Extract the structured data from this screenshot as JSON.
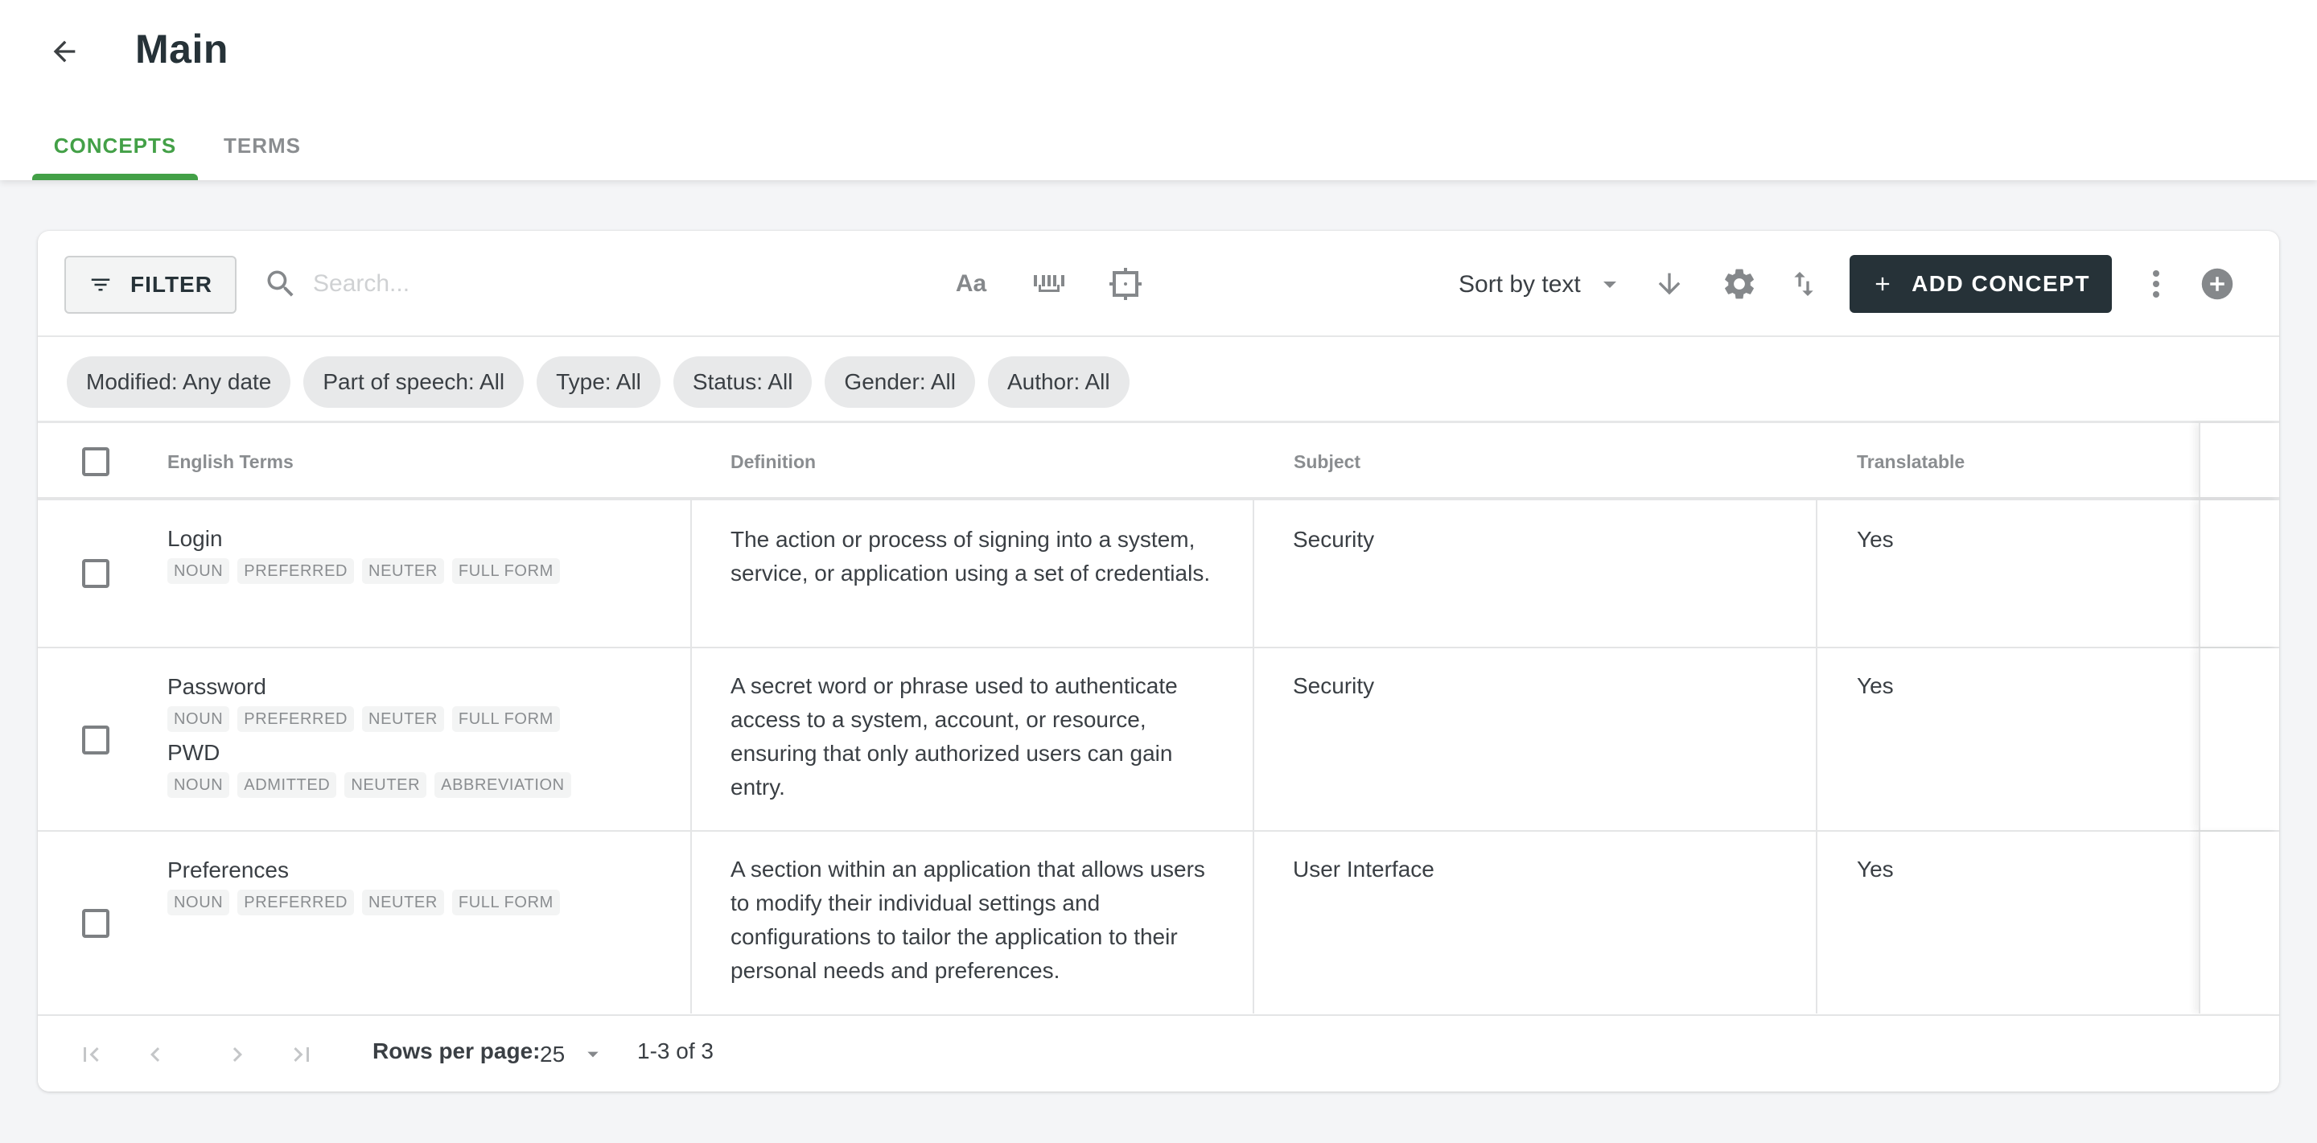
{
  "header": {
    "back_icon": "arrow-left-icon",
    "title": "Main",
    "tabs": [
      {
        "label": "CONCEPTS",
        "active": true
      },
      {
        "label": "TERMS",
        "active": false
      }
    ],
    "accent_color": "#43a047"
  },
  "toolbar": {
    "filter_label": "FILTER",
    "filter_icon": "filter-list-icon",
    "search_icon": "search-icon",
    "search_placeholder": "Search...",
    "search_value": "",
    "case_toggle_label": "Aa",
    "case_toggle_icon": "match-case-icon",
    "whole_word_icon": "whole-word-icon",
    "exact_match_icon": "exact-match-icon",
    "sort_label": "Sort by text",
    "sort_dropdown_icon": "caret-down-icon",
    "sort_direction_icon": "arrow-down-icon",
    "settings_icon": "gear-icon",
    "swap_icon": "swap-vertical-icon",
    "add_concept_label": "ADD CONCEPT",
    "add_concept_icon": "plus-icon",
    "more_icon": "more-vertical-icon",
    "add_circle_icon": "add-circle-icon",
    "primary_button_color": "#263238"
  },
  "filters": [
    {
      "label": "Modified: Any date"
    },
    {
      "label": "Part of speech: All"
    },
    {
      "label": "Type: All"
    },
    {
      "label": "Status: All"
    },
    {
      "label": "Gender: All"
    },
    {
      "label": "Author: All"
    }
  ],
  "table": {
    "columns": [
      "English Terms",
      "Definition",
      "Subject",
      "Translatable"
    ],
    "rows": [
      {
        "terms": [
          {
            "name": "Login",
            "tags": [
              "NOUN",
              "PREFERRED",
              "NEUTER",
              "FULL FORM"
            ]
          }
        ],
        "definition": "The action or process of signing into a system, service, or application using a set of credentials.",
        "subject": "Security",
        "translatable": "Yes",
        "checked": false
      },
      {
        "terms": [
          {
            "name": "Password",
            "tags": [
              "NOUN",
              "PREFERRED",
              "NEUTER",
              "FULL FORM"
            ]
          },
          {
            "name": "PWD",
            "tags": [
              "NOUN",
              "ADMITTED",
              "NEUTER",
              "ABBREVIATION"
            ]
          }
        ],
        "definition": "A secret word or phrase used to authenticate access to a system, account, or resource, ensuring that only authorized users can gain entry.",
        "subject": "Security",
        "translatable": "Yes",
        "checked": false
      },
      {
        "terms": [
          {
            "name": "Preferences",
            "tags": [
              "NOUN",
              "PREFERRED",
              "NEUTER",
              "FULL FORM"
            ]
          }
        ],
        "definition": "A section within an application that allows users to modify their individual settings and configurations to tailor the application to their personal needs and preferences.",
        "subject": "User Interface",
        "translatable": "Yes",
        "checked": false
      }
    ]
  },
  "pagination": {
    "first_icon": "first-page-icon",
    "prev_icon": "chevron-left-icon",
    "next_icon": "chevron-right-icon",
    "last_icon": "last-page-icon",
    "rows_per_page_label": "Rows per page:",
    "rows_per_page_value": "25",
    "range_text": "1-3 of 3"
  }
}
